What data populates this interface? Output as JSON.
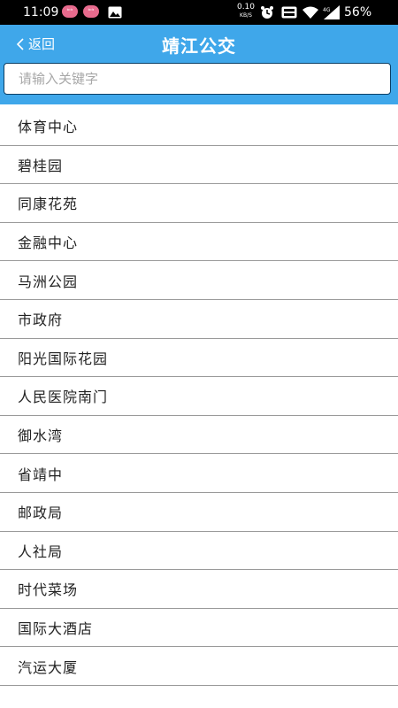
{
  "status_bar": {
    "time": "11:09",
    "notif_one": "ᵇᶦˡᶦ",
    "notif_two": "ᵇᶦˡᶦ",
    "net_speed": "0.10",
    "net_unit": "KB/S",
    "battery": "56%",
    "icons": [
      "gallery-icon",
      "alarm-icon",
      "volte-icon",
      "wifi-icon",
      "signal-4g-icon"
    ]
  },
  "app_bar": {
    "back_label": "返回",
    "title": "靖江公交",
    "color": "#3fa7ea"
  },
  "search": {
    "placeholder": "请输入关键字",
    "value": ""
  },
  "stops": [
    "体育中心",
    "碧桂园",
    "同康花苑",
    "金融中心",
    "马洲公园",
    "市政府",
    "阳光国际花园",
    "人民医院南门",
    "御水湾",
    "省靖中",
    "邮政局",
    "人社局",
    "时代菜场",
    "国际大酒店",
    "汽运大厦"
  ]
}
